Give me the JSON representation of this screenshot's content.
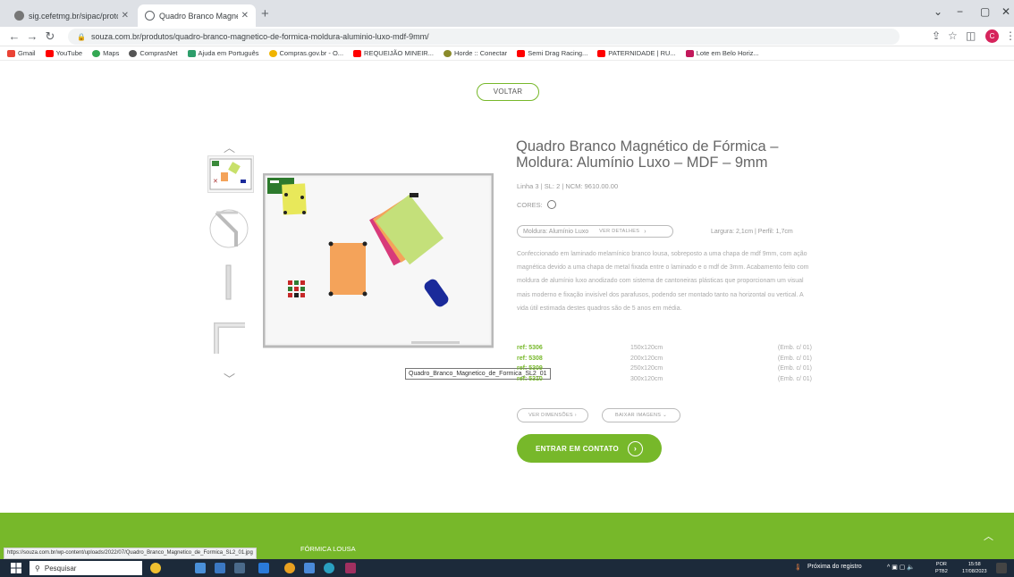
{
  "browser": {
    "tabs": [
      {
        "title": "sig.cefetmg.br/sipac/protocolo/"
      },
      {
        "title": "Quadro Branco Magnético de F..."
      }
    ],
    "url": "souza.com.br/produtos/quadro-branco-magnetico-de-formica-moldura-aluminio-luxo-mdf-9mm/",
    "bookmarks": [
      "Gmail",
      "YouTube",
      "Maps",
      "ComprasNet",
      "Ajuda em Português",
      "Compras.gov.br - O...",
      "REQUEIJÃO MINEIR...",
      "Horde :: Conectar",
      "Semi Drag Racing...",
      "PATERNIDADE | RU...",
      "Lote em Belo Horiz..."
    ],
    "profile_initial": "C"
  },
  "page": {
    "voltar": "VOLTAR",
    "title": "Quadro Branco Magnético de Fórmica – Moldura: Alumínio Luxo – MDF – 9mm",
    "meta": "Linha 3 | SL: 2 | NCM: 9610.00.00",
    "cores_label": "CORES:",
    "moldura_label": "Moldura: Alumínio Luxo",
    "ver_detalhes": "VER DETALHES",
    "largura": "Largura: 2,1cm | Perfil: 1,7cm",
    "description": "Confeccionado em laminado melamínico branco lousa, sobreposto a uma chapa de mdf 9mm, com ação magnética devido a uma chapa de metal fixada entre o laminado e o mdf de 3mm. Acabamento feito com moldura de alumínio luxo anodizado com sistema de cantoneiras plásticas que proporcionam um visual mais moderno e fixação invisível dos parafusos, podendo ser montado tanto na horizontal ou vertical. A vida útil estimada destes quadros são de 5 anos em média.",
    "refs": [
      {
        "ref": "ref: 5306",
        "dim": "150x120cm",
        "emb": "(Emb. c/ 01)"
      },
      {
        "ref": "ref: 5308",
        "dim": "200x120cm",
        "emb": "(Emb. c/ 01)"
      },
      {
        "ref": "ref: 5309",
        "dim": "250x120cm",
        "emb": "(Emb. c/ 01)"
      },
      {
        "ref": "ref: 5310",
        "dim": "300x120cm",
        "emb": "(Emb. c/ 01)"
      }
    ],
    "ver_dimensoes": "VER DIMENSÕES",
    "baixar_imagens": "BAIXAR IMAGENS",
    "entrar_contato": "ENTRAR EM CONTATO",
    "tooltip": "Quadro_Branco_Magnetico_de_Formica_SL2_01",
    "footer_label": "FÓRMICA LOUSA",
    "status_url": "https://souza.com.br/wp-content/uploads/2022/07/Quadro_Branco_Magnetico_de_Formica_SL2_01.jpg"
  },
  "taskbar": {
    "search": "Pesquisar",
    "weather": "Próxima do registro",
    "lang": "POR",
    "lang2": "PTB2",
    "time": "15:58",
    "date": "17/08/2023"
  }
}
